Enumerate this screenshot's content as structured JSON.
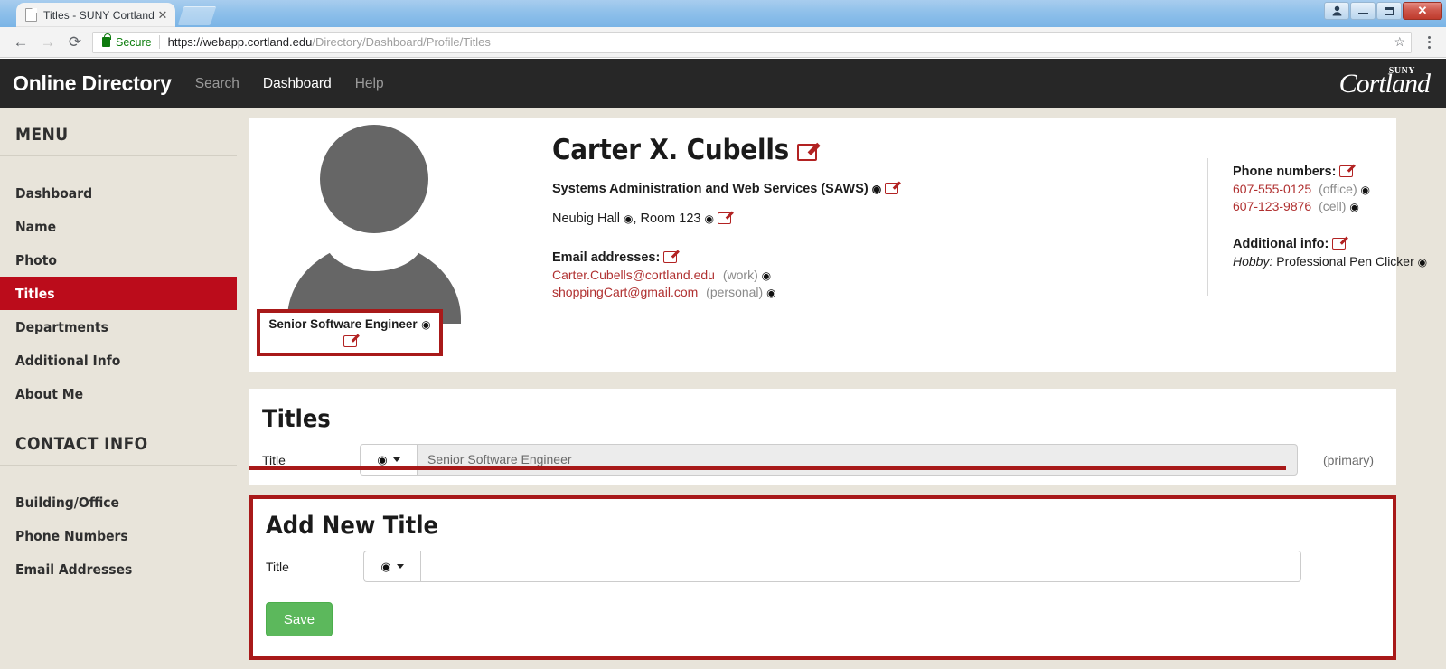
{
  "browser": {
    "tab_title": "Titles - SUNY Cortland O",
    "close_tab_glyph": "✕",
    "back_glyph": "←",
    "forward_glyph": "→",
    "reload_glyph": "⟳",
    "secure_label": "Secure",
    "url_host": "https://webapp.cortland.edu",
    "url_path": "/Directory/Dashboard/Profile/Titles",
    "star_glyph": "☆",
    "window_user_glyph": "☃",
    "window_close_glyph": "✕"
  },
  "header": {
    "brand": "Online Directory",
    "nav": [
      {
        "label": "Search",
        "active": false
      },
      {
        "label": "Dashboard",
        "active": true
      },
      {
        "label": "Help",
        "active": false
      }
    ],
    "logo_text": "Cortland",
    "logo_sup": "SUNY"
  },
  "sidebar": {
    "menu_heading": "MENU",
    "menu_items": [
      {
        "label": "Dashboard",
        "active": false
      },
      {
        "label": "Name",
        "active": false
      },
      {
        "label": "Photo",
        "active": false
      },
      {
        "label": "Titles",
        "active": true
      },
      {
        "label": "Departments",
        "active": false
      },
      {
        "label": "Additional Info",
        "active": false
      },
      {
        "label": "About Me",
        "active": false
      }
    ],
    "contact_heading": "CONTACT INFO",
    "contact_items": [
      {
        "label": "Building/Office"
      },
      {
        "label": "Phone Numbers"
      },
      {
        "label": "Email Addresses"
      }
    ]
  },
  "profile": {
    "name": "Carter X. Cubells",
    "badge_title": "Senior Software Engineer",
    "department": "Systems Administration and Web Services (SAWS)",
    "building": "Neubig Hall",
    "room_label": "Room",
    "room_number": "123",
    "emails_heading": "Email addresses:",
    "emails": [
      {
        "address": "Carter.Cubells@cortland.edu",
        "kind": "(work)"
      },
      {
        "address": "shoppingCart@gmail.com",
        "kind": "(personal)"
      }
    ],
    "phones_heading": "Phone numbers:",
    "phones": [
      {
        "number": "607-555-0125",
        "kind": "(office)"
      },
      {
        "number": "607-123-9876",
        "kind": "(cell)"
      }
    ],
    "additional_heading": "Additional info:",
    "additional_key": "Hobby:",
    "additional_value": "Professional Pen Clicker",
    "eye_glyph": "◉",
    "edit_icon": "pencil-icon"
  },
  "titles_section": {
    "heading": "Titles",
    "row_label": "Title",
    "row_value": "Senior Software Engineer",
    "primary_tag": "(primary)"
  },
  "add_new": {
    "heading": "Add New Title",
    "row_label": "Title",
    "input_value": "",
    "input_placeholder": "",
    "save_label": "Save"
  },
  "colors": {
    "accent_red": "#bb0c1b",
    "annotation_red": "#a81919",
    "sidebar_bg": "#e8e4da",
    "header_bg": "#272727",
    "save_green": "#5cb85c",
    "link_red": "#b03030"
  }
}
